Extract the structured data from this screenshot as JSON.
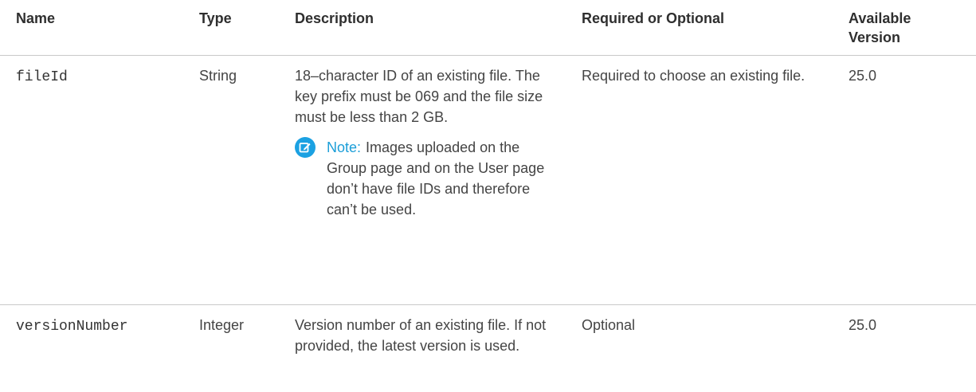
{
  "headers": {
    "name": "Name",
    "type": "Type",
    "description": "Description",
    "required": "Required or Optional",
    "version": "Available Version"
  },
  "rows": [
    {
      "name": "fileId",
      "type": "String",
      "description": "18–character ID of an existing file. The key prefix must be 069 and the file size must be less than 2 GB.",
      "note_label": "Note:",
      "note_text": "Images uploaded on the Group page and on the User page don’t have file IDs and therefore can’t be used.",
      "required": "Required to choose an existing file.",
      "version": "25.0"
    },
    {
      "name": "versionNumber",
      "type": "Integer",
      "description": "Version number of an existing file. If not provided, the latest version is used.",
      "required": "Optional",
      "version": "25.0"
    }
  ],
  "icons": {
    "note": "edit-note-icon"
  },
  "colors": {
    "note_accent": "#1ba1e2",
    "header_text": "#2f2f2f",
    "body_text": "#444444",
    "rule": "#c9c9c9"
  }
}
